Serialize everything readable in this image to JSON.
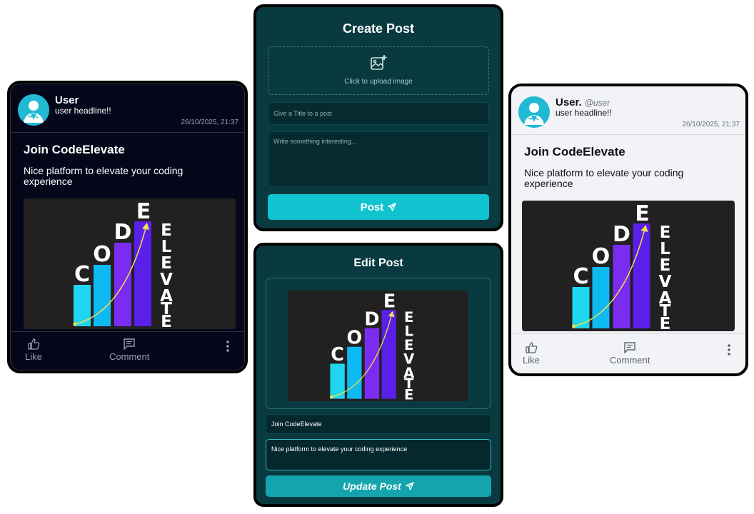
{
  "dark_card": {
    "user_name": "User",
    "headline": "user headline!!",
    "timestamp": "26/10/2025, 21:37",
    "title": "Join CodeElevate",
    "body": "Nice platform to elevate your coding experience",
    "actions": {
      "like": "Like",
      "comment": "Comment"
    }
  },
  "create_post": {
    "heading": "Create Post",
    "upload_text": "Click to upload image",
    "title_placeholder": "Give a Title to a post",
    "body_placeholder": "Write something interesting...",
    "submit_label": "Post"
  },
  "edit_post": {
    "heading": "Edit Post",
    "title_value": "Join CodeElevate",
    "body_value": "Nice platform to elevate your coding experience",
    "submit_label": "Update Post"
  },
  "light_card": {
    "user_name": "User.",
    "handle": "@user",
    "headline": "user headline!!",
    "timestamp": "26/10/2025, 21:37",
    "title": "Join CodeElevate",
    "body": "Nice platform to elevate your coding experience",
    "actions": {
      "like": "Like",
      "comment": "Comment"
    }
  },
  "logo_text": [
    "C",
    "O",
    "D",
    "E",
    "ELEVATE"
  ],
  "colors": {
    "panel_bg": "#083a3f",
    "accent": "#10c3cf",
    "dark_card_bg": "#04061a",
    "light_card_bg": "#f1f3f7",
    "avatar_bg": "#22b9d5"
  },
  "icons": [
    "avatar-icon",
    "image-plus-icon",
    "send-icon",
    "thumbs-up-icon",
    "comment-icon",
    "more-vertical-icon"
  ]
}
